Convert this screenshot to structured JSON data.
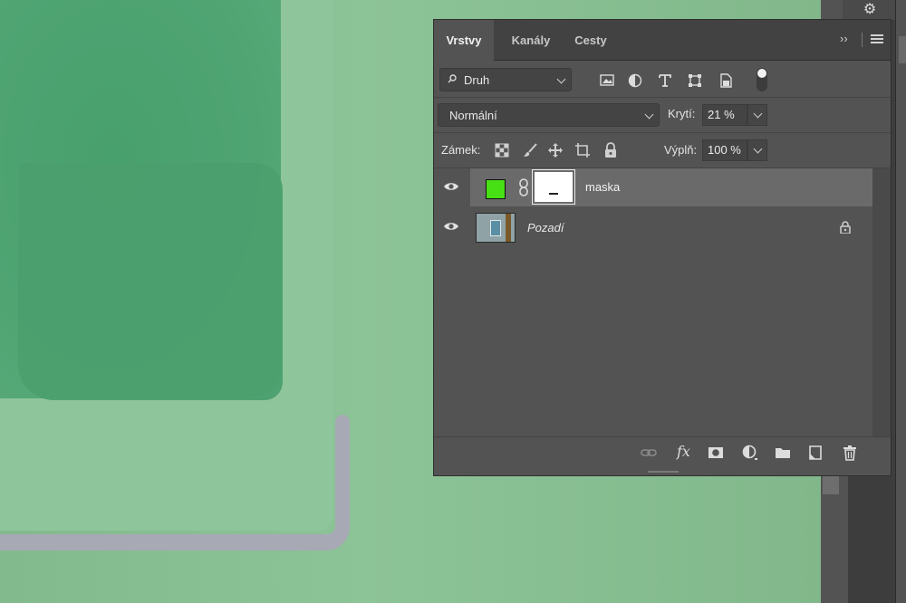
{
  "panel": {
    "tabs": [
      {
        "label": "Vrstvy",
        "active": true
      },
      {
        "label": "Kanály",
        "active": false
      },
      {
        "label": "Cesty",
        "active": false
      }
    ],
    "collapse_glyph": "››"
  },
  "filter": {
    "kind_select": "Druh",
    "filter_icons": [
      "image-filter-icon",
      "adjustment-filter-icon",
      "type-filter-icon",
      "shape-filter-icon",
      "smart-object-filter-icon"
    ]
  },
  "blend": {
    "mode": "Normální",
    "opacity_label": "Krytí:",
    "opacity_value": "21 %"
  },
  "lock": {
    "label": "Zámek:",
    "fill_label": "Výplň:",
    "fill_value": "100 %"
  },
  "layers": [
    {
      "name": "maska",
      "selected": true,
      "visible": true,
      "fill_color": "#47e014",
      "has_mask": true
    },
    {
      "name": "Pozadí",
      "selected": false,
      "visible": true,
      "locked": true
    }
  ],
  "bottom_toolbar": {
    "fx_label": "fx"
  },
  "colors": {
    "panel_bg": "#535353",
    "selected_layer": "#6a6a6a",
    "swatch_green": "#47e014",
    "canvas_green": "#86bd90"
  }
}
